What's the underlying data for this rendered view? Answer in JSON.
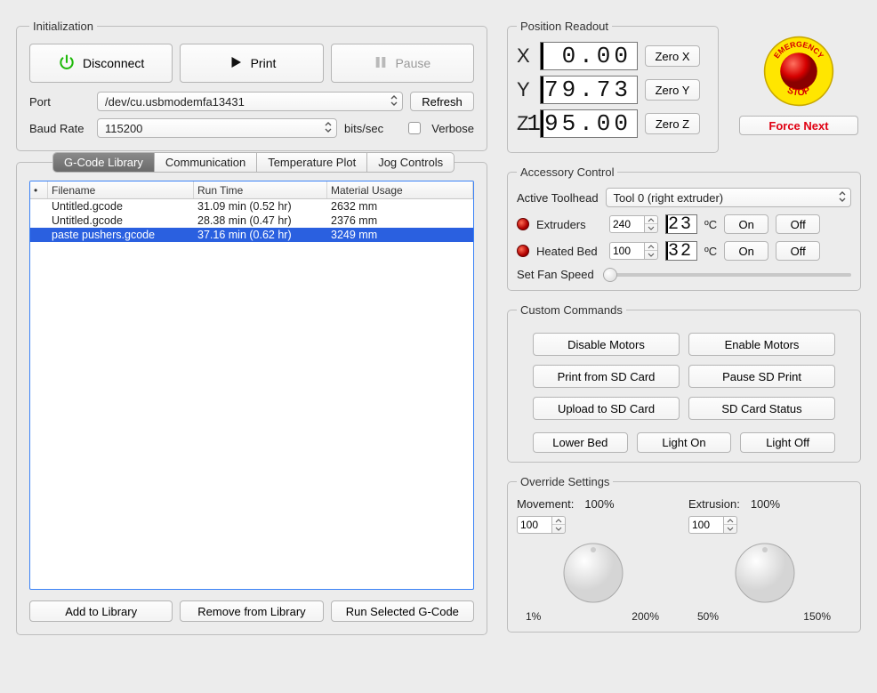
{
  "initialization": {
    "legend": "Initialization",
    "disconnect": "Disconnect",
    "print": "Print",
    "pause": "Pause",
    "port_label": "Port",
    "port_value": "/dev/cu.usbmodemfa13431",
    "refresh": "Refresh",
    "baud_label": "Baud Rate",
    "baud_value": "115200",
    "baud_unit": "bits/sec",
    "verbose_label": "Verbose"
  },
  "tabs": {
    "items": [
      "G-Code Library",
      "Communication",
      "Temperature Plot",
      "Jog Controls"
    ],
    "active_index": 0
  },
  "gcode_table": {
    "columns": [
      "",
      "Filename",
      "Run Time",
      "Material Usage"
    ],
    "rows": [
      {
        "filename": "Untitled.gcode",
        "runtime": "31.09 min (0.52 hr)",
        "material": "2632 mm",
        "selected": false
      },
      {
        "filename": "Untitled.gcode",
        "runtime": "28.38 min (0.47 hr)",
        "material": "2376 mm",
        "selected": false
      },
      {
        "filename": "paste pushers.gcode",
        "runtime": "37.16 min (0.62 hr)",
        "material": "3249 mm",
        "selected": true
      }
    ],
    "add_btn": "Add to Library",
    "remove_btn": "Remove from Library",
    "run_btn": "Run Selected G-Code"
  },
  "position": {
    "legend": "Position Readout",
    "axes": [
      {
        "label": "X",
        "value": "0.00",
        "zero": "Zero X"
      },
      {
        "label": "Y",
        "value": "79.73",
        "zero": "Zero Y"
      },
      {
        "label": "Z",
        "value": "195.00",
        "zero": "Zero Z"
      }
    ]
  },
  "estop": {
    "force_next": "Force Next"
  },
  "accessory": {
    "legend": "Accessory Control",
    "toolhead_label": "Active Toolhead",
    "toolhead_value": "Tool 0 (right extruder)",
    "extruders_label": "Extruders",
    "extruders_set": "240",
    "extruders_temp": "23",
    "bed_label": "Heated Bed",
    "bed_set": "100",
    "bed_temp": "32",
    "degc": "ºC",
    "on": "On",
    "off": "Off",
    "fan_label": "Set Fan Speed"
  },
  "custom": {
    "legend": "Custom Commands",
    "disable_motors": "Disable Motors",
    "enable_motors": "Enable Motors",
    "print_sd": "Print from SD Card",
    "pause_sd": "Pause SD Print",
    "upload_sd": "Upload to SD Card",
    "sd_status": "SD Card Status",
    "lower_bed": "Lower Bed",
    "light_on": "Light On",
    "light_off": "Light Off"
  },
  "override": {
    "legend": "Override Settings",
    "movement_label": "Movement:",
    "movement_pct": "100%",
    "movement_val": "100",
    "movement_scale_l": "1%",
    "movement_scale_r": "200%",
    "extrusion_label": "Extrusion:",
    "extrusion_pct": "100%",
    "extrusion_val": "100",
    "extrusion_scale_l": "50%",
    "extrusion_scale_r": "150%"
  }
}
